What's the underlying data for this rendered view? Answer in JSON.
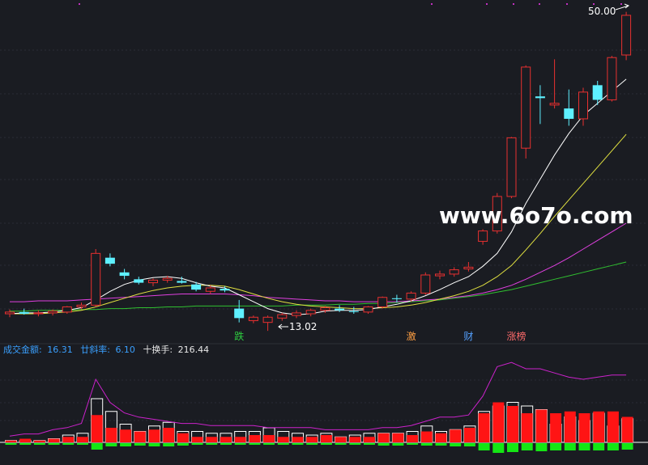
{
  "watermark": "www.6o7o.com",
  "chart_data": {
    "type": "candlestick",
    "main_panel": {
      "annotations": {
        "high": "50.00",
        "low": "13.02"
      },
      "event_tags": [
        {
          "label": "跌",
          "index": 16,
          "color": "#2ecc40"
        },
        {
          "label": "激",
          "index": 28,
          "color": "#ff9f43"
        },
        {
          "label": "财",
          "index": 32,
          "color": "#54a0ff"
        },
        {
          "label": "涨榜",
          "index": 35,
          "color": "#ff6b6b"
        }
      ],
      "colors": {
        "up": "#e83030",
        "down": "#5ef0ff",
        "ma_white": "#ffffff",
        "ma_yellow": "#e0e040",
        "ma_magenta": "#e040e0",
        "ma_green": "#30c030"
      },
      "candles": [
        [
          15.0,
          15.5,
          14.6,
          15.2
        ],
        [
          15.2,
          15.6,
          14.9,
          15.0
        ],
        [
          15.0,
          15.4,
          14.7,
          15.1
        ],
        [
          15.1,
          15.5,
          14.8,
          15.3
        ],
        [
          15.2,
          15.9,
          15.0,
          15.8
        ],
        [
          15.8,
          16.3,
          15.5,
          16.0
        ],
        [
          16.0,
          22.5,
          15.8,
          22.0
        ],
        [
          21.5,
          22.0,
          20.5,
          20.8
        ],
        [
          19.8,
          20.2,
          19.0,
          19.4
        ],
        [
          19.0,
          19.3,
          18.4,
          18.6
        ],
        [
          18.6,
          19.1,
          18.2,
          18.9
        ],
        [
          18.9,
          19.4,
          18.6,
          19.1
        ],
        [
          18.8,
          19.3,
          18.5,
          18.6
        ],
        [
          18.4,
          18.7,
          17.6,
          17.8
        ],
        [
          17.6,
          18.3,
          17.3,
          18.0
        ],
        [
          17.9,
          18.2,
          17.5,
          17.7
        ],
        [
          15.6,
          16.6,
          14.0,
          14.5
        ],
        [
          14.2,
          14.8,
          13.9,
          14.6
        ],
        [
          14.0,
          14.8,
          13.02,
          14.6
        ],
        [
          14.5,
          15.1,
          14.2,
          14.9
        ],
        [
          14.8,
          15.4,
          14.5,
          15.1
        ],
        [
          15.0,
          15.6,
          14.7,
          15.4
        ],
        [
          15.4,
          15.9,
          15.1,
          15.7
        ],
        [
          15.6,
          16.0,
          15.2,
          15.4
        ],
        [
          15.3,
          15.8,
          15.0,
          15.2
        ],
        [
          15.2,
          15.9,
          15.0,
          15.8
        ],
        [
          15.8,
          17.0,
          15.6,
          16.9
        ],
        [
          16.8,
          17.2,
          16.3,
          16.7
        ],
        [
          16.7,
          17.6,
          16.4,
          17.4
        ],
        [
          17.4,
          19.8,
          17.2,
          19.5
        ],
        [
          19.4,
          20.0,
          19.0,
          19.6
        ],
        [
          19.6,
          20.4,
          19.3,
          20.1
        ],
        [
          20.2,
          21.0,
          19.9,
          20.4
        ],
        [
          23.4,
          24.8,
          23.0,
          24.6
        ],
        [
          24.6,
          29.0,
          24.3,
          28.6
        ],
        [
          28.6,
          35.5,
          28.4,
          35.4
        ],
        [
          34.2,
          43.8,
          33.0,
          43.6
        ],
        [
          40.2,
          41.5,
          37.0,
          40.0
        ],
        [
          39.2,
          44.5,
          38.8,
          39.4
        ],
        [
          38.8,
          41.0,
          36.8,
          37.6
        ],
        [
          37.6,
          41.2,
          36.8,
          40.7
        ],
        [
          41.5,
          42.0,
          39.2,
          39.8
        ],
        [
          39.8,
          44.9,
          39.6,
          44.7
        ],
        [
          45.0,
          50.0,
          44.4,
          49.6
        ]
      ],
      "ma_white": [
        15.0,
        15.1,
        15.1,
        15.2,
        15.4,
        15.7,
        16.6,
        17.6,
        18.4,
        18.9,
        19.2,
        19.3,
        19.1,
        18.6,
        18.2,
        18.0,
        17.2,
        16.4,
        15.6,
        15.1,
        14.9,
        15.0,
        15.3,
        15.4,
        15.4,
        15.5,
        15.8,
        16.1,
        16.5,
        17.1,
        17.8,
        18.6,
        19.3,
        20.5,
        22.0,
        24.5,
        27.8,
        30.6,
        33.4,
        35.9,
        38.0,
        39.4,
        40.8,
        42.2
      ],
      "ma_yellow": [
        15.0,
        15.0,
        15.0,
        15.1,
        15.2,
        15.4,
        15.8,
        16.3,
        16.8,
        17.3,
        17.7,
        18.0,
        18.2,
        18.3,
        18.3,
        18.2,
        17.8,
        17.3,
        16.8,
        16.4,
        16.1,
        15.9,
        15.8,
        15.7,
        15.6,
        15.6,
        15.7,
        15.8,
        16.0,
        16.3,
        16.7,
        17.1,
        17.6,
        18.3,
        19.3,
        20.6,
        22.4,
        24.3,
        26.3,
        28.2,
        30.1,
        32.0,
        33.9,
        35.8
      ],
      "ma_magenta": [
        16.4,
        16.4,
        16.5,
        16.5,
        16.5,
        16.6,
        16.7,
        16.8,
        16.9,
        17.0,
        17.1,
        17.2,
        17.3,
        17.3,
        17.3,
        17.3,
        17.2,
        17.1,
        16.9,
        16.8,
        16.7,
        16.6,
        16.5,
        16.5,
        16.4,
        16.4,
        16.4,
        16.4,
        16.5,
        16.6,
        16.7,
        16.9,
        17.1,
        17.4,
        17.8,
        18.3,
        19.0,
        19.8,
        20.6,
        21.5,
        22.5,
        23.5,
        24.5,
        25.5
      ],
      "ma_green": [
        15.3,
        15.3,
        15.4,
        15.4,
        15.4,
        15.5,
        15.5,
        15.6,
        15.6,
        15.7,
        15.7,
        15.8,
        15.8,
        15.9,
        15.9,
        15.9,
        15.9,
        15.9,
        15.9,
        15.9,
        16.0,
        16.0,
        16.0,
        16.1,
        16.1,
        16.2,
        16.2,
        16.3,
        16.4,
        16.5,
        16.6,
        16.8,
        17.0,
        17.2,
        17.5,
        17.8,
        18.2,
        18.6,
        19.0,
        19.4,
        19.8,
        20.2,
        20.6,
        21.0
      ]
    },
    "indicator_panel": {
      "labels": [
        {
          "name": "成交金额:",
          "value": "16.31",
          "color": "#3aa0ff"
        },
        {
          "name": "廿斜率:",
          "value": "6.10",
          "color": "#3aa0ff"
        },
        {
          "name": "十换手:",
          "value": "216.44",
          "color": "#e8e8e8"
        }
      ],
      "bars": [
        [
          1,
          1
        ],
        [
          1,
          2
        ],
        [
          1,
          1
        ],
        [
          2,
          2
        ],
        [
          4,
          3
        ],
        [
          5,
          3
        ],
        [
          24,
          15
        ],
        [
          17,
          8
        ],
        [
          10,
          7
        ],
        [
          6,
          6
        ],
        [
          9,
          7
        ],
        [
          11,
          8
        ],
        [
          6,
          5
        ],
        [
          6,
          3
        ],
        [
          5,
          3
        ],
        [
          5,
          3
        ],
        [
          6,
          3
        ],
        [
          6,
          4
        ],
        [
          8,
          4
        ],
        [
          6,
          3
        ],
        [
          5,
          3
        ],
        [
          4,
          3
        ],
        [
          5,
          4
        ],
        [
          3,
          3
        ],
        [
          4,
          3
        ],
        [
          5,
          3
        ],
        [
          5,
          5
        ],
        [
          5,
          5
        ],
        [
          6,
          4
        ],
        [
          9,
          6
        ],
        [
          6,
          5
        ],
        [
          7,
          7
        ],
        [
          9,
          8
        ],
        [
          17,
          16
        ],
        [
          20,
          22
        ],
        [
          22,
          20
        ],
        [
          20,
          16
        ],
        [
          18,
          18
        ],
        [
          10,
          16
        ],
        [
          14,
          17
        ],
        [
          12,
          16
        ],
        [
          16,
          17
        ],
        [
          9,
          17
        ],
        [
          13,
          14
        ]
      ],
      "line": [
        3,
        4,
        4,
        6,
        7,
        9,
        30,
        19,
        14,
        12,
        11,
        10,
        9,
        9,
        8,
        8,
        8,
        8,
        7,
        7,
        7,
        7,
        6,
        6,
        6,
        6,
        7,
        7,
        8,
        10,
        12,
        12,
        13,
        22,
        36,
        38,
        35,
        35,
        33,
        31,
        30,
        31,
        32,
        32
      ],
      "colors": {
        "bar_up": "#ff1414",
        "bar_down": "#14e614",
        "bar_outline": "#ffffff",
        "line": "#cc22cc"
      }
    }
  }
}
